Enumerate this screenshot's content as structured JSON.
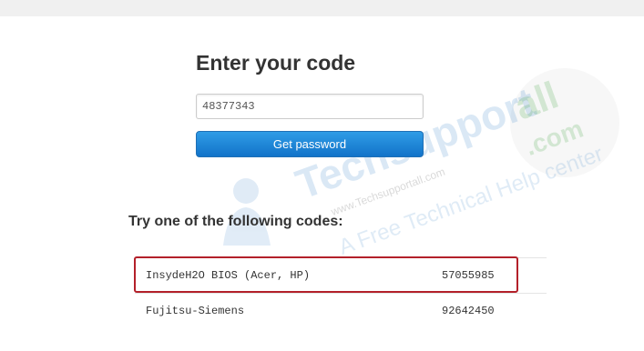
{
  "heading": "Enter your code",
  "code_input": {
    "value": "48377343"
  },
  "get_password_button": "Get password",
  "codes_heading": "Try one of the following codes:",
  "codes": [
    {
      "vendor": "InsydeH2O BIOS (Acer, HP)",
      "password": "57055985",
      "highlighted": true
    },
    {
      "vendor": "Fujitsu-Siemens",
      "password": "92642450",
      "highlighted": false
    }
  ],
  "watermark": {
    "brand": "Techsupport",
    "brand_suffix": "all",
    "domain_suffix": ".com",
    "url": "www.Techsupportall.com",
    "tagline": "A Free Technical Help center"
  },
  "colors": {
    "button_top": "#2f9ce6",
    "button_bottom": "#1273c9",
    "highlight_border": "#b3202a",
    "watermark_blue": "#1a6fc0",
    "watermark_green": "#2e9b2e"
  }
}
